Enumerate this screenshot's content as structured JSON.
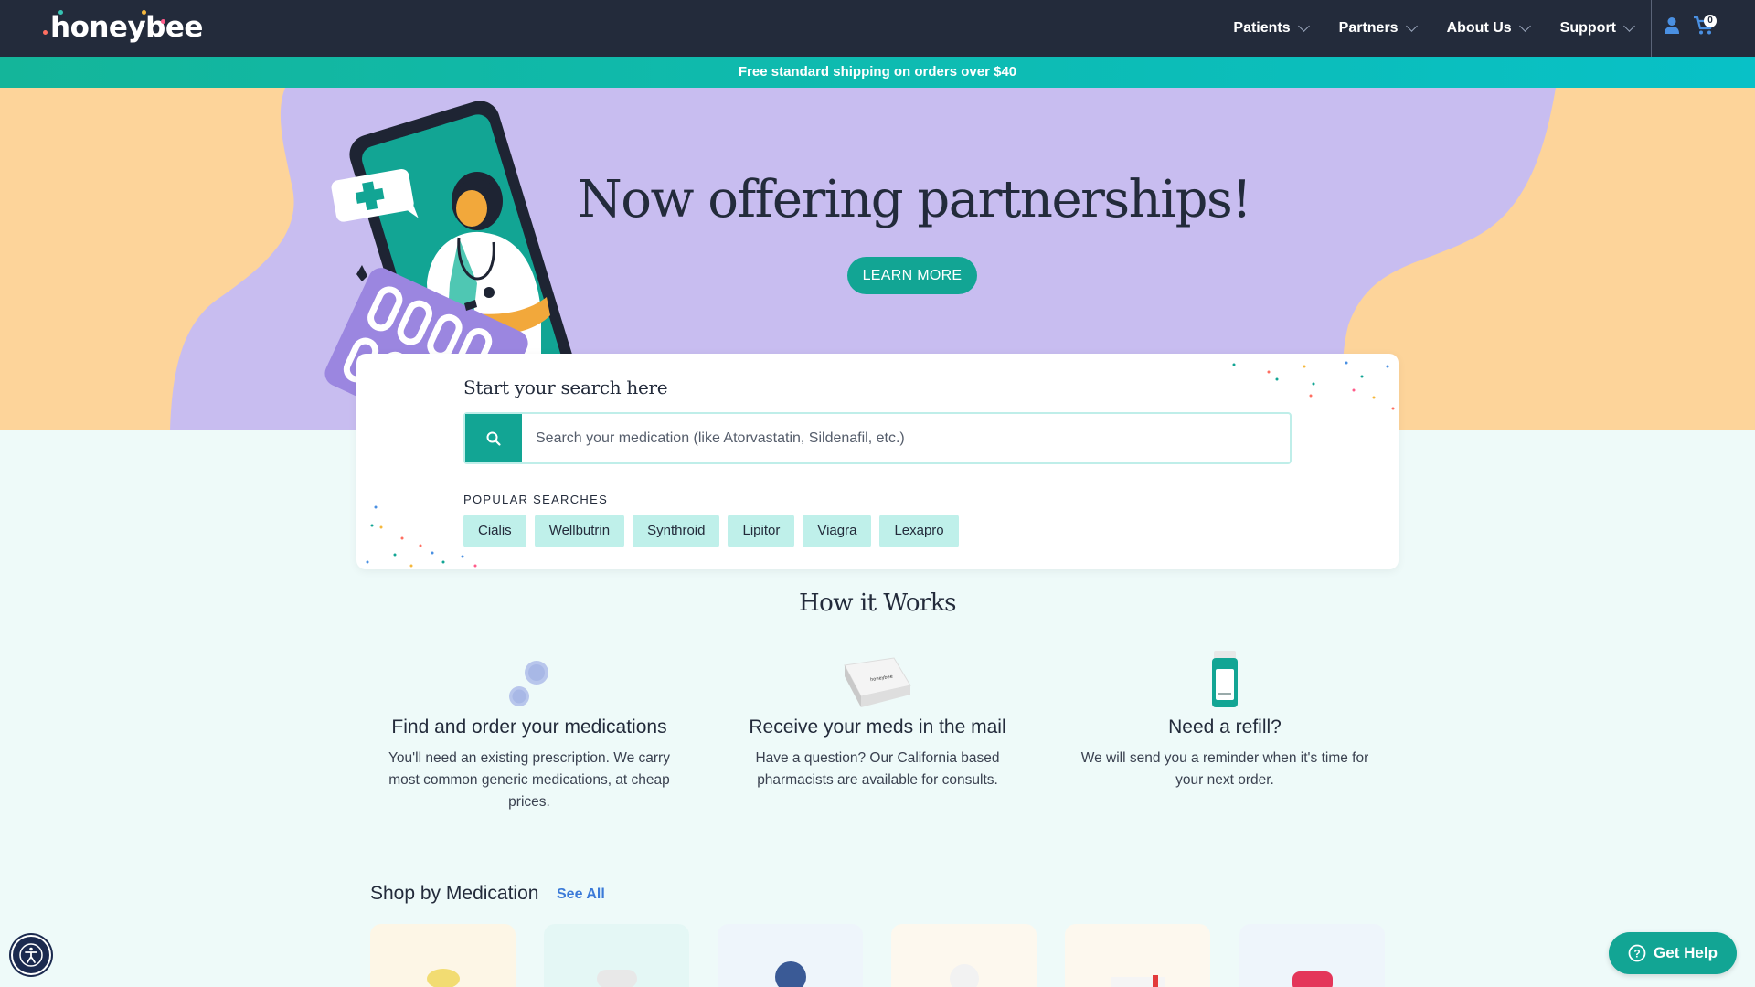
{
  "header": {
    "logo": "honeybee",
    "nav": [
      {
        "label": "Patients"
      },
      {
        "label": "Partners"
      },
      {
        "label": "About Us"
      },
      {
        "label": "Support"
      }
    ],
    "cart_count": "0"
  },
  "announcement": "Free standard shipping on orders over $40",
  "hero": {
    "title": "Now offering partnerships!",
    "button": "LEARN MORE"
  },
  "search": {
    "heading": "Start your search here",
    "placeholder": "Search your medication (like Atorvastatin, Sildenafil, etc.)",
    "popular_label": "POPULAR SEARCHES",
    "popular": [
      "Cialis",
      "Wellbutrin",
      "Synthroid",
      "Lipitor",
      "Viagra",
      "Lexapro"
    ]
  },
  "how": {
    "title": "How it Works",
    "steps": [
      {
        "title": "Find and order your medications",
        "desc": "You'll need an existing prescription. We carry most common generic medications, at cheap prices.",
        "icon": "pills-icon"
      },
      {
        "title": "Receive your meds in the mail",
        "desc": "Have a question? Our California based pharmacists are available for consults.",
        "icon": "package-icon",
        "package_label": "honeybee"
      },
      {
        "title": "Need a refill?",
        "desc": "We will send you a reminder when it's time for your next order.",
        "icon": "bottle-icon"
      }
    ]
  },
  "shop": {
    "title": "Shop by Medication",
    "see_all": "See All",
    "cards": [
      {
        "bg": "#fdf6e6",
        "pill": "#f2dc72"
      },
      {
        "bg": "#e4f7f5",
        "pill": "#e8e8e8"
      },
      {
        "bg": "#eef5fb",
        "pill": "#3a5a96"
      },
      {
        "bg": "#fdf8ee",
        "pill": "#f2f2f2"
      },
      {
        "bg": "#fdf8ee",
        "pill": "#e33b3b"
      },
      {
        "bg": "#eef5fb",
        "pill": "#e4365a"
      }
    ]
  },
  "help": {
    "label": "Get Help"
  },
  "colors": {
    "brand": "#12a594",
    "header": "#232b3b",
    "hero_purple": "#c8bdf0",
    "hero_peach": "#fdd49a"
  }
}
